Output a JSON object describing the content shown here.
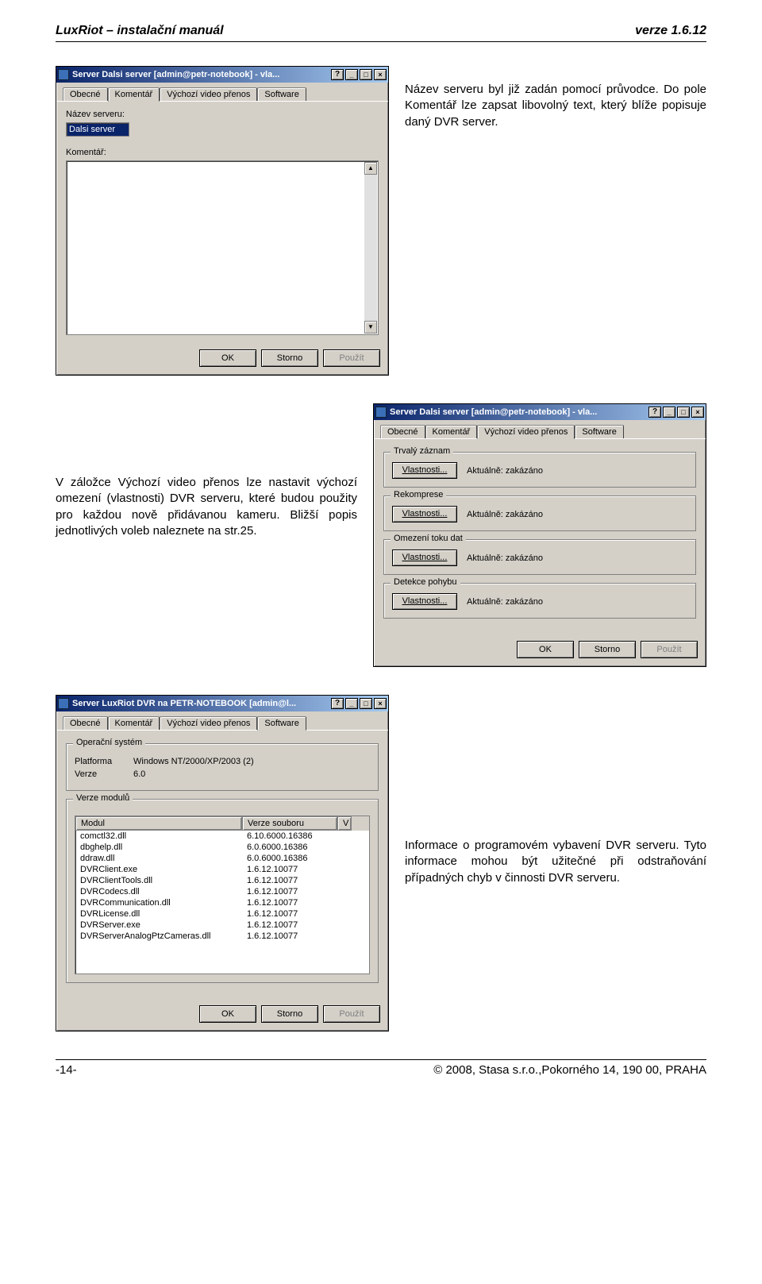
{
  "header": {
    "left": "LuxRiot – instalační manuál",
    "right": "verze 1.6.12"
  },
  "section1": {
    "desc": "Název serveru byl již zadán pomocí průvodce. Do pole Komentář lze zapsat libovolný text, který blíže popisuje daný DVR server.",
    "window": {
      "title": "Server Dalsi server [admin@petr-notebook] - vla...",
      "tabs": [
        "Obecné",
        "Komentář",
        "Výchozí video přenos",
        "Software"
      ],
      "active_tab": 1,
      "label_name": "Název serveru:",
      "val_name": "Dalsi server",
      "label_comment": "Komentář:",
      "ok": "OK",
      "cancel": "Storno",
      "apply": "Použít"
    }
  },
  "section2": {
    "desc": "V záložce Výchozí video přenos lze nastavit výchozí omezení (vlastnosti) DVR serveru, které budou použity pro každou nově přidávanou kameru. Bližší popis jednotlivých voleb naleznete na str.25.",
    "window": {
      "title": "Server Dalsi server [admin@petr-notebook] - vla...",
      "tabs": [
        "Obecné",
        "Komentář",
        "Výchozí video přenos",
        "Software"
      ],
      "active_tab": 2,
      "groups": [
        {
          "title": "Trvalý záznam",
          "btn": "Vlastnosti...",
          "status": "Aktuálně: zakázáno"
        },
        {
          "title": "Rekomprese",
          "btn": "Vlastnosti...",
          "status": "Aktuálně: zakázáno"
        },
        {
          "title": "Omezení toku dat",
          "btn": "Vlastnosti...",
          "status": "Aktuálně: zakázáno"
        },
        {
          "title": "Detekce pohybu",
          "btn": "Vlastnosti...",
          "status": "Aktuálně: zakázáno"
        }
      ],
      "ok": "OK",
      "cancel": "Storno",
      "apply": "Použít"
    }
  },
  "section3": {
    "desc": "Informace o programovém vybavení DVR serveru. Tyto informace mohou být užitečné při odstraňování případných chyb v činnosti DVR serveru.",
    "window": {
      "title": "Server LuxRiot DVR na PETR-NOTEBOOK [admin@l...",
      "tabs": [
        "Obecné",
        "Komentář",
        "Výchozí video přenos",
        "Software"
      ],
      "active_tab": 3,
      "os_group": "Operační systém",
      "platform_lbl": "Platforma",
      "platform_val": "Windows NT/2000/XP/2003 (2)",
      "ver_lbl": "Verze",
      "ver_val": "6.0",
      "mod_group": "Verze modulů",
      "col1": "Modul",
      "col2": "Verze souboru",
      "col3": "V",
      "rows": [
        {
          "m": "comctl32.dll",
          "v": "6.10.6000.16386"
        },
        {
          "m": "dbghelp.dll",
          "v": "6.0.6000.16386"
        },
        {
          "m": "ddraw.dll",
          "v": "6.0.6000.16386"
        },
        {
          "m": "DVRClient.exe",
          "v": "1.6.12.10077"
        },
        {
          "m": "DVRClientTools.dll",
          "v": "1.6.12.10077"
        },
        {
          "m": "DVRCodecs.dll",
          "v": "1.6.12.10077"
        },
        {
          "m": "DVRCommunication.dll",
          "v": "1.6.12.10077"
        },
        {
          "m": "DVRLicense.dll",
          "v": "1.6.12.10077"
        },
        {
          "m": "DVRServer.exe",
          "v": "1.6.12.10077"
        },
        {
          "m": "DVRServerAnalogPtzCameras.dll",
          "v": "1.6.12.10077"
        }
      ],
      "ok": "OK",
      "cancel": "Storno",
      "apply": "Použít"
    }
  },
  "footer": {
    "left": "-14-",
    "right": "© 2008, Stasa s.r.o.,Pokorného 14, 190 00, PRAHA"
  }
}
